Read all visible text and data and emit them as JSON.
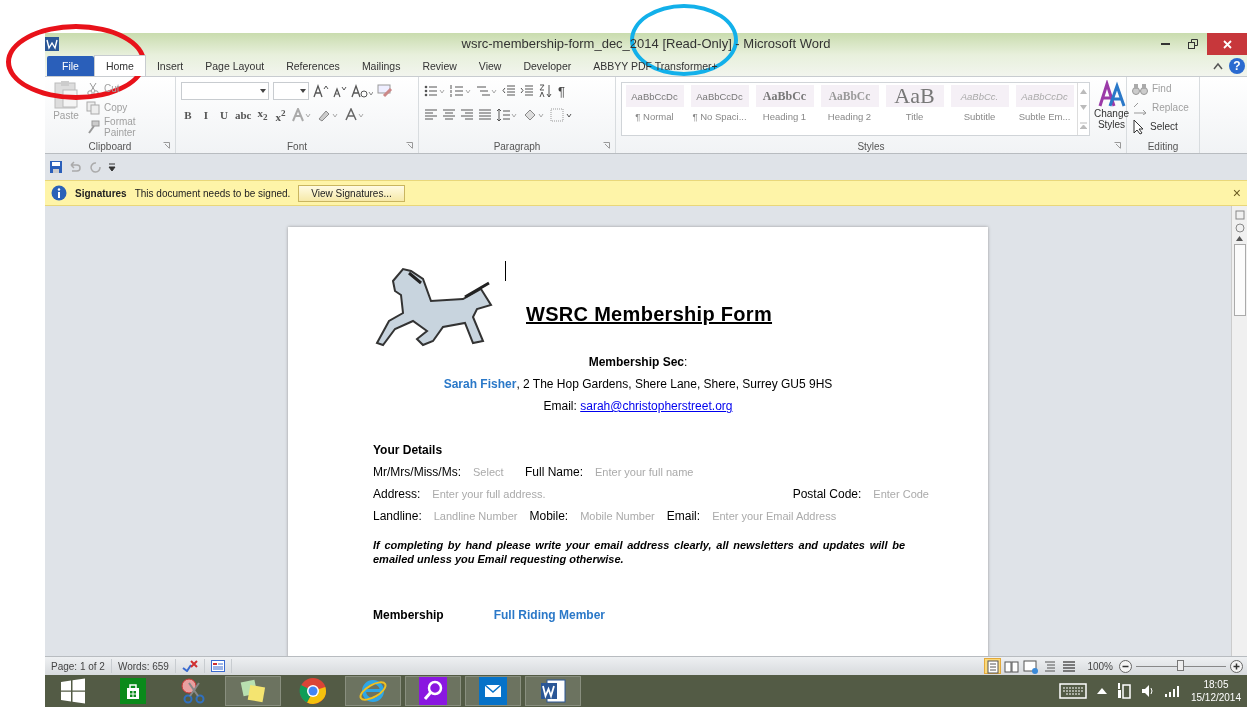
{
  "window": {
    "title": "wsrc-membership-form_dec_2014 [Read-Only]  -  Microsoft Word"
  },
  "tabs": [
    {
      "label": "File",
      "kind": "file",
      "selected": false
    },
    {
      "label": "Home",
      "kind": "tab",
      "selected": true
    },
    {
      "label": "Insert",
      "kind": "tab",
      "selected": false
    },
    {
      "label": "Page Layout",
      "kind": "tab",
      "selected": false
    },
    {
      "label": "References",
      "kind": "tab",
      "selected": false
    },
    {
      "label": "Mailings",
      "kind": "tab",
      "selected": false
    },
    {
      "label": "Review",
      "kind": "tab",
      "selected": false
    },
    {
      "label": "View",
      "kind": "tab",
      "selected": false
    },
    {
      "label": "Developer",
      "kind": "tab",
      "selected": false
    },
    {
      "label": "ABBYY PDF Transformer+",
      "kind": "tab",
      "selected": false
    }
  ],
  "ribbon": {
    "clipboard": {
      "label": "Clipboard",
      "paste": {
        "label": "Paste",
        "disabled": true
      },
      "items": [
        {
          "label": "Cut",
          "kind": "scissors",
          "disabled": true
        },
        {
          "label": "Copy",
          "kind": "copy",
          "disabled": true
        },
        {
          "label": "Format Painter",
          "kind": "brush",
          "disabled": true
        }
      ]
    },
    "font": {
      "label": "Font",
      "buttons": [
        "B",
        "I",
        "U",
        "abc",
        "x$_{2}$",
        "x$^{2}$"
      ]
    },
    "paragraph": {
      "label": "Paragraph",
      "pilcrow": "¶"
    },
    "styles": {
      "label": "Styles",
      "items": [
        {
          "preview": "AaBbCcDc",
          "name": "¶ Normal",
          "kind": "normal"
        },
        {
          "preview": "AaBbCcDc",
          "name": "¶ No Spaci...",
          "kind": "normal"
        },
        {
          "preview": "AaBbCc",
          "name": "Heading 1",
          "kind": "heading"
        },
        {
          "preview": "AaBbCc",
          "name": "Heading 2",
          "kind": "heading2"
        },
        {
          "preview": "AaB",
          "name": "Title",
          "kind": "title"
        },
        {
          "preview": "AaBbCc.",
          "name": "Subtitle",
          "kind": "italic"
        },
        {
          "preview": "AaBbCcDc",
          "name": "Subtle Em...",
          "kind": "italic"
        }
      ],
      "change_styles": "Change Styles"
    },
    "editing": {
      "label": "Editing",
      "items": [
        {
          "label": "Find",
          "kind": "binoculars",
          "disabled": true
        },
        {
          "label": "Replace",
          "kind": "replace",
          "disabled": true
        },
        {
          "label": "Select",
          "kind": "cursor",
          "disabled": false
        }
      ]
    },
    "help": "?"
  },
  "message_bar": {
    "title": "Signatures",
    "text": "This document needs to be signed.",
    "button": "View Signatures...",
    "close": "×"
  },
  "document": {
    "title": "WSRC Membership Form",
    "secretary_label": "**Membership Sec**:",
    "secretary_address": "**Sarah Fisher**, 2 The Hop Gardens, Shere Lane, Shere, Surrey GU5 9HS",
    "email_label": "Email:",
    "email_link": "sarah@christopherstreet.org",
    "section": "Your Details",
    "lines": [
      {
        "fields": [
          {
            "label": "Mr/Mrs/Miss/Ms:",
            "placeholder": "Select"
          },
          {
            "label": "Full Name:",
            "placeholder": "Enter your full name"
          }
        ]
      },
      {
        "fields": [
          {
            "label": "Address:",
            "placeholder": "Enter your full address."
          },
          {
            "label": "Postal  Code:",
            "placeholder": "Enter Code"
          }
        ]
      },
      {
        "fields": [
          {
            "label": "Landline:",
            "placeholder": "Landline Number"
          },
          {
            "label": "Mobile:",
            "placeholder": "Mobile Number"
          },
          {
            "label": "Email:",
            "placeholder": "Enter your Email Address"
          }
        ]
      }
    ],
    "note": "If completing by hand please write your email address clearly, all newsletters and updates will be emailed unless you Email requesting  otherwise.",
    "membership_label": "Membership",
    "membership_value": "Full Riding Member"
  },
  "status_bar": {
    "page": "Page: 1 of 2",
    "words": "Words: 659",
    "views": [
      {
        "kind": "print",
        "selected": true
      },
      {
        "kind": "reading",
        "selected": false
      },
      {
        "kind": "web",
        "selected": false
      },
      {
        "kind": "outline",
        "selected": false
      },
      {
        "kind": "draft",
        "selected": false
      }
    ],
    "zoom": "100%",
    "zoom_slider": {
      "level": 0.5
    }
  },
  "taskbar": {
    "apps": [
      {
        "kind": "store",
        "running": false
      },
      {
        "kind": "snip",
        "running": false
      },
      {
        "kind": "notes",
        "running": true
      },
      {
        "kind": "chrome",
        "running": false
      },
      {
        "kind": "ie",
        "running": true
      },
      {
        "kind": "search",
        "running": true
      },
      {
        "kind": "mail",
        "running": true
      },
      {
        "kind": "word",
        "running": true
      }
    ],
    "time": "18:05",
    "date": "15/12/2014"
  },
  "annotations": [
    {
      "kind": "circle",
      "color": "#e8121a"
    },
    {
      "kind": "circle",
      "color": "#12b0ea"
    }
  ]
}
